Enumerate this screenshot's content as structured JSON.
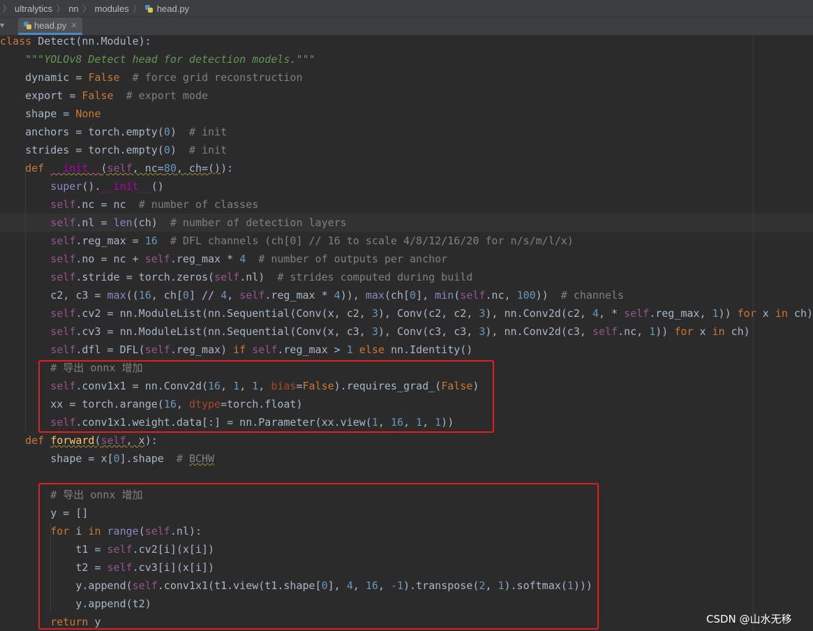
{
  "breadcrumb": {
    "items": [
      "ultralytics",
      "nn",
      "modules"
    ],
    "file": "head.py"
  },
  "tabs": [
    {
      "label": "head.py",
      "active": true
    }
  ],
  "colors": {
    "background": "#2b2b2b",
    "keyword": "#cc7832",
    "self": "#94558d",
    "number": "#6897bb",
    "comment": "#808080",
    "docstring": "#629755",
    "function": "#ffc66d",
    "highlight_box": "#e02020"
  },
  "code_lines": [
    [
      [
        "kw",
        "class "
      ],
      [
        "",
        "Detect(nn.Module):"
      ]
    ],
    [
      [
        "",
        "    "
      ],
      [
        "doc",
        "\"\"\"YOLOv8 Detect head for detection models.\"\"\""
      ]
    ],
    [
      [
        "",
        "    dynamic = "
      ],
      [
        "kw",
        "False"
      ],
      [
        "",
        "  "
      ],
      [
        "cmt",
        "# force grid reconstruction"
      ]
    ],
    [
      [
        "",
        "    export = "
      ],
      [
        "kw",
        "False"
      ],
      [
        "",
        "  "
      ],
      [
        "cmt",
        "# export mode"
      ]
    ],
    [
      [
        "",
        "    shape = "
      ],
      [
        "kw",
        "None"
      ]
    ],
    [
      [
        "",
        "    anchors = torch.empty("
      ],
      [
        "num",
        "0"
      ],
      [
        "",
        ")  "
      ],
      [
        "cmt",
        "# init"
      ]
    ],
    [
      [
        "",
        "    strides = torch.empty("
      ],
      [
        "num",
        "0"
      ],
      [
        "",
        ")  "
      ],
      [
        "cmt",
        "# init"
      ]
    ],
    [
      [
        "",
        "    "
      ],
      [
        "kw",
        "def "
      ],
      [
        "magic warn",
        "__init__"
      ],
      [
        "warn",
        "("
      ],
      [
        "self warn",
        "self"
      ],
      [
        "warn",
        ", nc="
      ],
      [
        "num warn",
        "80"
      ],
      [
        "warn",
        ", ch=()"
      ],
      [
        "",
        ")"
      ],
      [
        "",
        ":"
      ]
    ],
    [
      [
        "",
        "        "
      ],
      [
        "bi",
        "super"
      ],
      [
        "",
        "()."
      ],
      [
        "magic",
        "__init__"
      ],
      [
        "",
        "()"
      ]
    ],
    [
      [
        "",
        "        "
      ],
      [
        "self",
        "self"
      ],
      [
        "",
        ".nc = nc  "
      ],
      [
        "cmt",
        "# number of classes"
      ]
    ],
    [
      [
        "",
        "        "
      ],
      [
        "self",
        "self"
      ],
      [
        "",
        ".nl = "
      ],
      [
        "bi",
        "len"
      ],
      [
        "",
        "(ch)  "
      ],
      [
        "cmt",
        "# number of detection layers"
      ]
    ],
    [
      [
        "",
        "        "
      ],
      [
        "self",
        "self"
      ],
      [
        "",
        ".reg_max = "
      ],
      [
        "num",
        "16"
      ],
      [
        "",
        "  "
      ],
      [
        "cmt",
        "# DFL channels (ch[0] // 16 to scale 4/8/12/16/20 for n/s/m/l/x)"
      ]
    ],
    [
      [
        "",
        "        "
      ],
      [
        "self",
        "self"
      ],
      [
        "",
        ".no = nc + "
      ],
      [
        "self",
        "self"
      ],
      [
        "",
        ".reg_max * "
      ],
      [
        "num",
        "4"
      ],
      [
        "",
        "  "
      ],
      [
        "cmt",
        "# number of outputs per anchor"
      ]
    ],
    [
      [
        "",
        "        "
      ],
      [
        "self",
        "self"
      ],
      [
        "",
        ".stride = torch.zeros("
      ],
      [
        "self",
        "self"
      ],
      [
        "",
        ".nl)  "
      ],
      [
        "cmt",
        "# strides computed during build"
      ]
    ],
    [
      [
        "",
        "        c2, c3 = "
      ],
      [
        "bi",
        "max"
      ],
      [
        "",
        "(("
      ],
      [
        "num",
        "16"
      ],
      [
        "",
        ", ch["
      ],
      [
        "num",
        "0"
      ],
      [
        "",
        "] // "
      ],
      [
        "num",
        "4"
      ],
      [
        "",
        ", "
      ],
      [
        "self",
        "self"
      ],
      [
        "",
        ".reg_max * "
      ],
      [
        "num",
        "4"
      ],
      [
        "",
        ")), "
      ],
      [
        "bi",
        "max"
      ],
      [
        "",
        "(ch["
      ],
      [
        "num",
        "0"
      ],
      [
        "",
        "], "
      ],
      [
        "bi",
        "min"
      ],
      [
        "",
        "("
      ],
      [
        "self",
        "self"
      ],
      [
        "",
        ".nc, "
      ],
      [
        "num",
        "100"
      ],
      [
        "",
        "))  "
      ],
      [
        "cmt",
        "# channels"
      ]
    ],
    [
      [
        "",
        "        "
      ],
      [
        "self",
        "self"
      ],
      [
        "",
        ".cv2 = nn.ModuleList(nn.Sequential(Conv(x, c2, "
      ],
      [
        "num",
        "3"
      ],
      [
        "",
        "), Conv(c2, c2, "
      ],
      [
        "num",
        "3"
      ],
      [
        "",
        "), nn.Conv2d(c2, "
      ],
      [
        "num",
        "4"
      ],
      [
        "",
        ", * "
      ],
      [
        "self",
        "self"
      ],
      [
        "",
        ".reg_max, "
      ],
      [
        "num",
        "1"
      ],
      [
        "",
        ")) "
      ],
      [
        "kw",
        "for "
      ],
      [
        "",
        "x "
      ],
      [
        "kw",
        "in "
      ],
      [
        "",
        "ch)"
      ]
    ],
    [
      [
        "",
        "        "
      ],
      [
        "self",
        "self"
      ],
      [
        "",
        ".cv3 = nn.ModuleList(nn.Sequential(Conv(x, c3, "
      ],
      [
        "num",
        "3"
      ],
      [
        "",
        "), Conv(c3, c3, "
      ],
      [
        "num",
        "3"
      ],
      [
        "",
        "), nn.Conv2d(c3, "
      ],
      [
        "self",
        "self"
      ],
      [
        "",
        ".nc, "
      ],
      [
        "num",
        "1"
      ],
      [
        "",
        ")) "
      ],
      [
        "kw",
        "for "
      ],
      [
        "",
        "x "
      ],
      [
        "kw",
        "in "
      ],
      [
        "",
        "ch)"
      ]
    ],
    [
      [
        "",
        "        "
      ],
      [
        "self",
        "self"
      ],
      [
        "",
        ".dfl = DFL("
      ],
      [
        "self",
        "self"
      ],
      [
        "",
        ".reg_max) "
      ],
      [
        "kw",
        "if "
      ],
      [
        "self",
        "self"
      ],
      [
        "",
        ".reg_max > "
      ],
      [
        "num",
        "1"
      ],
      [
        "kw",
        " else "
      ],
      [
        "",
        "nn.Identity()"
      ]
    ],
    [
      [
        "",
        "        "
      ],
      [
        "cmt",
        "# 导出 onnx 增加"
      ]
    ],
    [
      [
        "",
        "        "
      ],
      [
        "self",
        "self"
      ],
      [
        "",
        ".conv1x1 = nn.Conv2d("
      ],
      [
        "num",
        "16"
      ],
      [
        "",
        ", "
      ],
      [
        "num",
        "1"
      ],
      [
        "",
        ", "
      ],
      [
        "num",
        "1"
      ],
      [
        "",
        ", "
      ],
      [
        "param",
        "bias"
      ],
      [
        "",
        "="
      ],
      [
        "kw",
        "False"
      ],
      [
        "",
        ").requires_grad_("
      ],
      [
        "kw",
        "False"
      ],
      [
        "",
        ")"
      ]
    ],
    [
      [
        "",
        "        xx = torch.arange("
      ],
      [
        "num",
        "16"
      ],
      [
        "",
        ", "
      ],
      [
        "param",
        "dtype"
      ],
      [
        "",
        "=torch.float)"
      ]
    ],
    [
      [
        "",
        "        "
      ],
      [
        "self",
        "self"
      ],
      [
        "",
        ".conv1x1.weight.data[:] = nn.Parameter(xx.view("
      ],
      [
        "num",
        "1"
      ],
      [
        "",
        ", "
      ],
      [
        "num",
        "16"
      ],
      [
        "",
        ", "
      ],
      [
        "num",
        "1"
      ],
      [
        "",
        ", "
      ],
      [
        "num",
        "1"
      ],
      [
        "",
        "))"
      ]
    ],
    [
      [
        "",
        "    "
      ],
      [
        "kw",
        "def "
      ],
      [
        "fn warn",
        "forward"
      ],
      [
        "warn",
        "("
      ],
      [
        "self warn",
        "self"
      ],
      [
        "warn",
        ", x"
      ],
      [
        "",
        ")"
      ],
      [
        "",
        ":"
      ]
    ],
    [
      [
        "",
        "        shape = x["
      ],
      [
        "num",
        "0"
      ],
      [
        "",
        "].shape  "
      ],
      [
        "cmt",
        "# "
      ],
      [
        "cmt warn",
        "BCHW"
      ]
    ],
    [],
    [
      [
        "",
        "        "
      ],
      [
        "cmt",
        "# 导出 onnx 增加"
      ]
    ],
    [
      [
        "",
        "        y = []"
      ]
    ],
    [
      [
        "",
        "        "
      ],
      [
        "kw",
        "for "
      ],
      [
        "",
        "i "
      ],
      [
        "kw",
        "in "
      ],
      [
        "bi",
        "range"
      ],
      [
        "",
        "("
      ],
      [
        "self",
        "self"
      ],
      [
        "",
        ".nl):"
      ]
    ],
    [
      [
        "",
        "            t1 = "
      ],
      [
        "self",
        "self"
      ],
      [
        "",
        ".cv2[i](x[i])"
      ]
    ],
    [
      [
        "",
        "            t2 = "
      ],
      [
        "self",
        "self"
      ],
      [
        "",
        ".cv3[i](x[i])"
      ]
    ],
    [
      [
        "",
        "            y.append("
      ],
      [
        "self",
        "self"
      ],
      [
        "",
        ".conv1x1(t1.view(t1.shape["
      ],
      [
        "num",
        "0"
      ],
      [
        "",
        "], "
      ],
      [
        "num",
        "4"
      ],
      [
        "",
        ", "
      ],
      [
        "num",
        "16"
      ],
      [
        "",
        ", "
      ],
      [
        "num",
        "-1"
      ],
      [
        "",
        ").transpose("
      ],
      [
        "num",
        "2"
      ],
      [
        "",
        ", "
      ],
      [
        "num",
        "1"
      ],
      [
        "",
        ").softmax("
      ],
      [
        "num",
        "1"
      ],
      [
        "",
        ")))"
      ]
    ],
    [
      [
        "",
        "            y.append(t2)"
      ]
    ],
    [
      [
        "",
        "        "
      ],
      [
        "kw",
        "return "
      ],
      [
        "",
        "y"
      ]
    ]
  ],
  "watermark": "CSDN @山水无移"
}
